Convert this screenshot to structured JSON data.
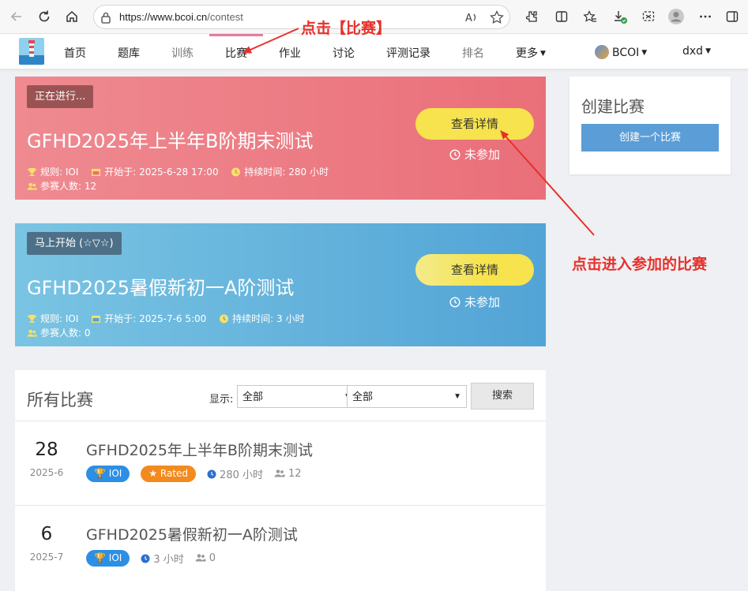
{
  "browser": {
    "url_host": "https://www.bcoi.cn",
    "url_path": "/contest"
  },
  "nav": {
    "items": [
      "首页",
      "题库",
      "训练",
      "比赛",
      "作业",
      "讨论",
      "评测记录",
      "排名",
      "更多"
    ],
    "user_site": "BCOI",
    "user_name": "dxd"
  },
  "featured": [
    {
      "badge": "正在进行...",
      "title": "GFHD2025年上半年B阶期末测试",
      "rule": "规则: IOI",
      "start": "开始于: 2025-6-28 17:00",
      "duration": "持续时间: 280 小时",
      "participants": "参赛人数: 12",
      "button": "查看详情",
      "status": "未参加"
    },
    {
      "badge": "马上开始 (☆▽☆)",
      "title": "GFHD2025暑假新初一A阶测试",
      "rule": "规则: IOI",
      "start": "开始于: 2025-7-6 5:00",
      "duration": "持续时间: 3 小时",
      "participants": "参赛人数: 0",
      "button": "查看详情",
      "status": "未参加"
    }
  ],
  "panel": {
    "title": "创建比赛",
    "button": "创建一个比赛"
  },
  "list": {
    "title": "所有比赛",
    "filter_label": "显示:",
    "select1": "全部",
    "select2": "全部",
    "search_button": "搜索",
    "rows": [
      {
        "day": "28",
        "ym": "2025-6",
        "title": "GFHD2025年上半年B阶期末测试",
        "rule_tag": "IOI",
        "rated_tag": "Rated",
        "duration": "280 小时",
        "count": "12"
      },
      {
        "day": "6",
        "ym": "2025-7",
        "title": "GFHD2025暑假新初一A阶测试",
        "rule_tag": "IOI",
        "duration": "3 小时",
        "count": "0"
      }
    ]
  },
  "annotations": {
    "top": "点击【比赛】",
    "right": "点击进入参加的比赛",
    "color": "#e8302b"
  },
  "colors": {
    "ongoing_card": "#ea6f79",
    "upcoming_card": "#52a4d6",
    "detail_button": "#f6e34d",
    "create_button": "#5b9dd6",
    "ioi_tag": "#2c8fe6",
    "rated_tag": "#f38a1e"
  }
}
